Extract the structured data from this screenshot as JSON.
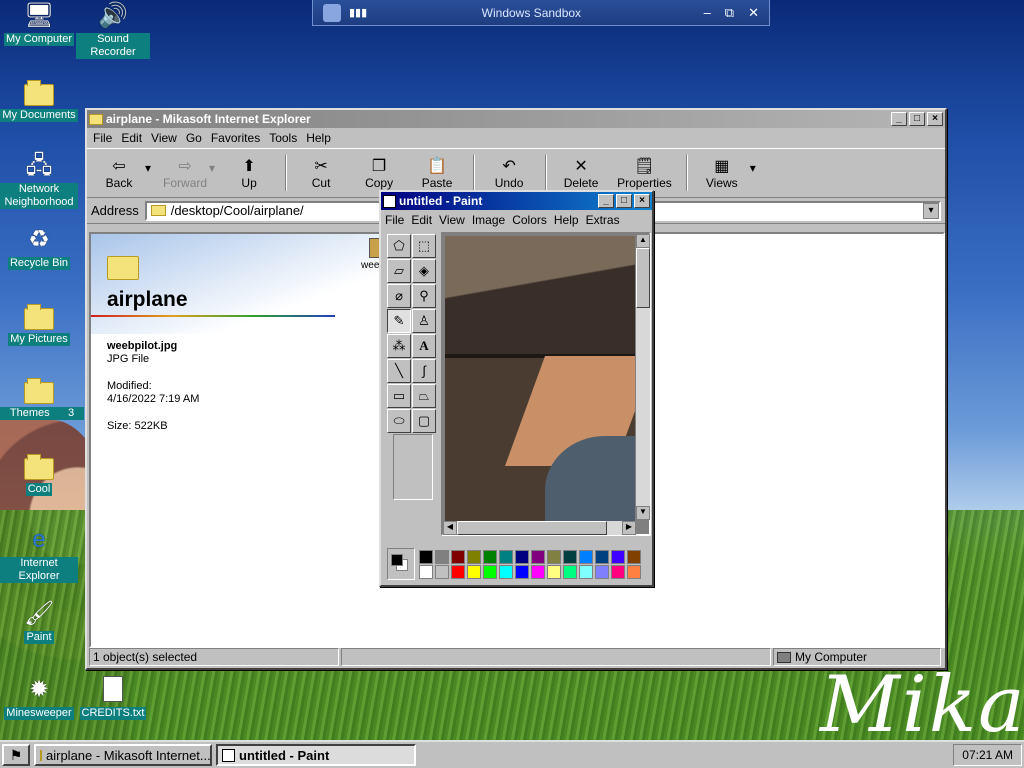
{
  "sandbox": {
    "title": "Windows Sandbox",
    "min": "–",
    "restore": "⧉",
    "close": "✕"
  },
  "desktop": {
    "brand": "Mikas",
    "icons": [
      {
        "label": "My Computer"
      },
      {
        "label": "Sound Recorder"
      },
      {
        "label": "My Documents"
      },
      {
        "label": "Network Neighborhood"
      },
      {
        "label": "Recycle Bin"
      },
      {
        "label": "My Pictures"
      },
      {
        "label": "Themes"
      },
      {
        "label": "Cool"
      },
      {
        "label": "Internet Explorer"
      },
      {
        "label": "Paint"
      },
      {
        "label": "Minesweeper"
      },
      {
        "label": "CREDITS.txt"
      }
    ],
    "themes_suffix": "3"
  },
  "ie": {
    "title": "airplane - Mikasoft Internet Explorer",
    "menu": [
      "File",
      "Edit",
      "View",
      "Go",
      "Favorites",
      "Tools",
      "Help"
    ],
    "toolbar": {
      "back": "Back",
      "forward": "Forward",
      "up": "Up",
      "cut": "Cut",
      "copy": "Copy",
      "paste": "Paste",
      "undo": "Undo",
      "delete": "Delete",
      "properties": "Properties",
      "views": "Views"
    },
    "address_label": "Address",
    "address_value": "/desktop/Cool/airplane/",
    "folder_title": "airplane",
    "file_name": "weebpilot.jpg",
    "file_type": "JPG File",
    "modified_label": "Modified:",
    "modified_value": "4/16/2022 7:19 AM",
    "size_label": "Size: 522KB",
    "file_icon_label": "weeb",
    "status_left": "1 object(s) selected",
    "status_right": "My Computer"
  },
  "paint": {
    "title": "untitled - Paint",
    "menu": [
      "File",
      "Edit",
      "View",
      "Image",
      "Colors",
      "Help",
      "Extras"
    ],
    "palette_top": [
      "#000000",
      "#808080",
      "#800000",
      "#808000",
      "#008000",
      "#008080",
      "#000080",
      "#800080",
      "#808040",
      "#004040",
      "#0080ff",
      "#004080",
      "#4000ff",
      "#804000"
    ],
    "palette_bottom": [
      "#ffffff",
      "#c0c0c0",
      "#ff0000",
      "#ffff00",
      "#00ff00",
      "#00ffff",
      "#0000ff",
      "#ff00ff",
      "#ffff80",
      "#00ff80",
      "#80ffff",
      "#8080ff",
      "#ff0080",
      "#ff8040"
    ]
  },
  "taskbar": {
    "tasks": [
      "airplane - Mikasoft Internet...",
      "untitled - Paint"
    ],
    "clock": "07:21 AM"
  }
}
